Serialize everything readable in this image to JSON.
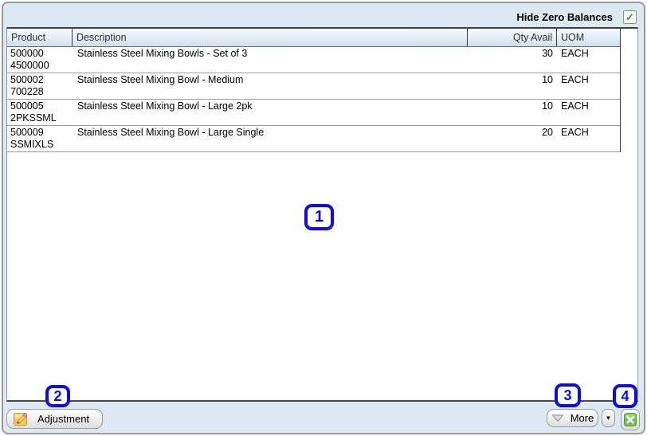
{
  "panel": {
    "hide_zero_balances_label": "Hide Zero Balances",
    "hide_zero_balances_checked": true
  },
  "icons": {
    "checkbox_check": "✓",
    "dropdown_arrow": "▼"
  },
  "table": {
    "columns": {
      "product": "Product",
      "description": "Description",
      "qty_avail": "Qty Avail",
      "uom": "UOM"
    },
    "rows": [
      {
        "product_code": "500000",
        "product_alt": "4500000",
        "description": "Stainless Steel Mixing Bowls - Set of 3",
        "qty_avail": "30",
        "uom": "EACH"
      },
      {
        "product_code": "500002",
        "product_alt": "700228",
        "description": "Stainless Steel Mixing Bowl - Medium",
        "qty_avail": "10",
        "uom": "EACH"
      },
      {
        "product_code": "500005",
        "product_alt": "2PKSSML",
        "description": "Stainless Steel Mixing Bowl - Large 2pk",
        "qty_avail": "10",
        "uom": "EACH"
      },
      {
        "product_code": "500009",
        "product_alt": "SSMIXLS",
        "description": "Stainless Steel Mixing Bowl - Large Single",
        "qty_avail": "20",
        "uom": "EACH"
      }
    ]
  },
  "annotations": {
    "badges": [
      "1",
      "2",
      "3",
      "4"
    ],
    "color": "#0d0ce3"
  },
  "toolbar": {
    "adjustment_label": "Adjustment",
    "more_label": "More",
    "adjustment_icon": "note-pencil-icon",
    "more_icon": "down-triangle-icon",
    "dropdown_icon": "dropdown-arrow-icon",
    "excel_icon": "excel-export-icon"
  },
  "colors": {
    "panel_bg": "#dce8f2",
    "check_green": "#2f9e23",
    "excel_green": "#72c14c",
    "annotation_blue": "#0d0ce3"
  }
}
